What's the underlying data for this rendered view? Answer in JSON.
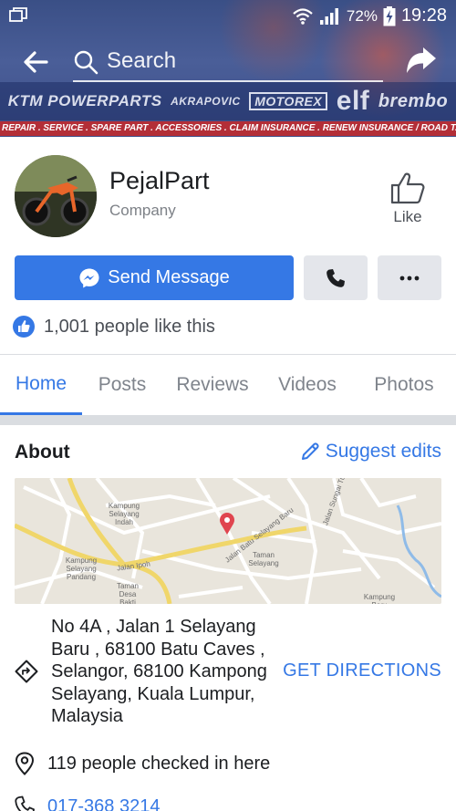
{
  "status_bar": {
    "battery": "72%",
    "time": "19:28"
  },
  "header": {
    "search_placeholder": "Search"
  },
  "cover": {
    "sponsors": [
      "KTM POWERPARTS",
      "AKRAPOVIC",
      "MOTOREX",
      "elf",
      "brembo"
    ],
    "services": "REPAIR . SERVICE . SPARE PART . ACCESSORIES . CLAIM INSURANCE . RENEW INSURANCE / ROAD TAX"
  },
  "page": {
    "name": "PejalPart",
    "category": "Company",
    "like_label": "Like"
  },
  "actions": {
    "send_message": "Send Message"
  },
  "likes": {
    "text": "1,001 people like this"
  },
  "tabs": [
    "Home",
    "Posts",
    "Reviews",
    "Videos",
    "Photos"
  ],
  "about": {
    "title": "About",
    "suggest_edits": "Suggest edits",
    "address": "No 4A , Jalan 1 Selayang Baru , 68100 Batu Caves , Selangor, 68100 Kampong Selayang, Kuala Lumpur, Malaysia",
    "get_directions": "GET DIRECTIONS",
    "checkins": "119 people checked in here",
    "phone": "017-368 3214"
  },
  "map": {
    "labels": [
      "Kampung Selayang Indah",
      "Kampung Selayang Pandang",
      "Taman Desa Bakti",
      "Taman Selayang",
      "Kampung Baru",
      "Jalan Ipoh",
      "Jalan Batu Selayang Baru",
      "Jalan Sungai Tua"
    ]
  },
  "colors": {
    "accent": "#3578e5",
    "marker": "#e0454f"
  }
}
